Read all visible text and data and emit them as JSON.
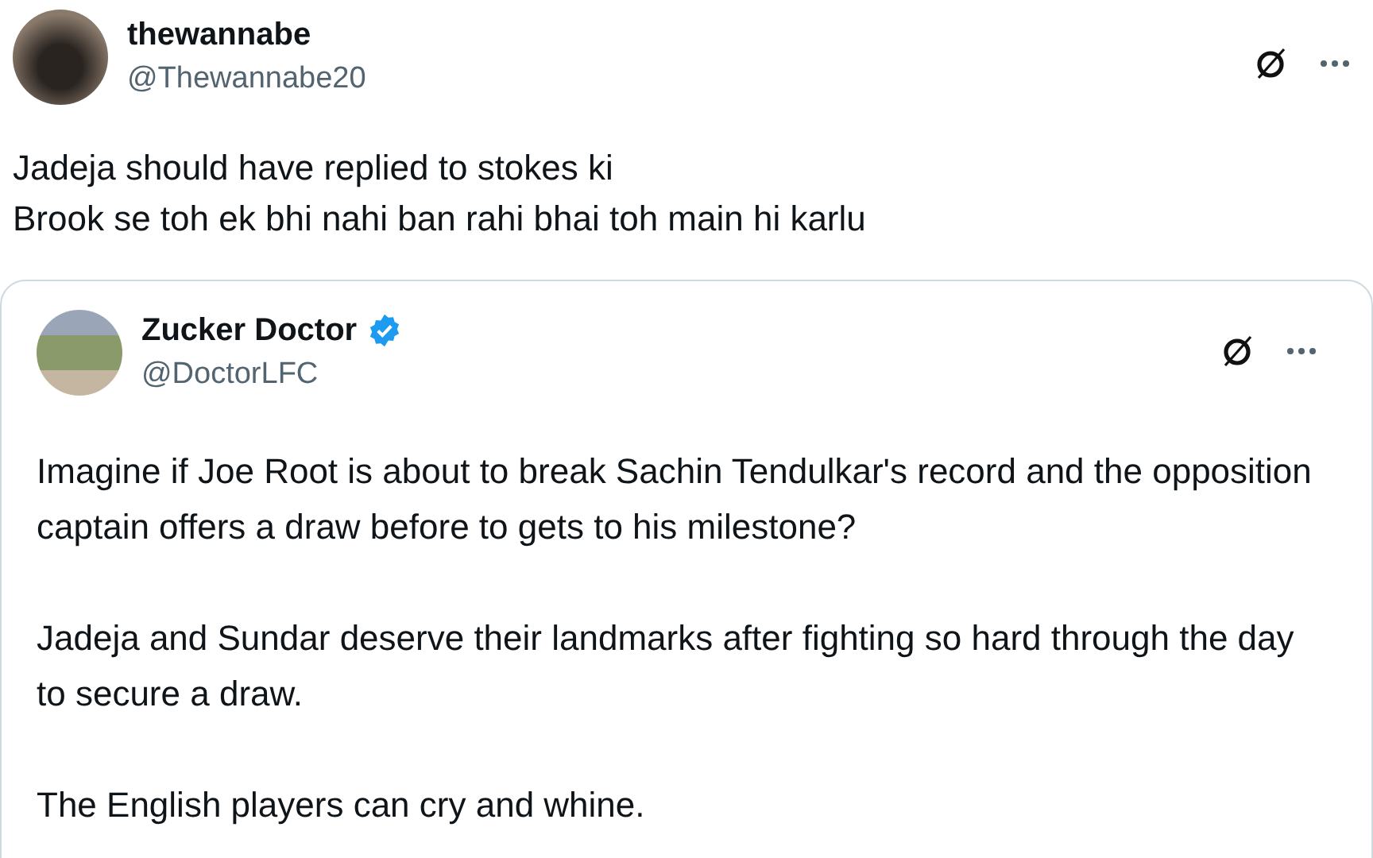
{
  "tweet": {
    "author": {
      "name": "thewannabe",
      "handle": "@Thewannabe20",
      "verified": false
    },
    "text": "Jadeja should have replied to stokes ki\nBrook se toh ek bhi nahi ban rahi bhai toh main hi karlu",
    "quoted": {
      "author": {
        "name": "Zucker Doctor",
        "handle": "@DoctorLFC",
        "verified": true
      },
      "paragraphs": [
        "Imagine if Joe Root is about to break Sachin Tendulkar's record and the opposition captain offers a draw before to gets to his milestone?",
        "Jadeja and Sundar deserve their landmarks after fighting so hard through the day to secure a draw.",
        "The English players can cry and whine."
      ]
    }
  }
}
